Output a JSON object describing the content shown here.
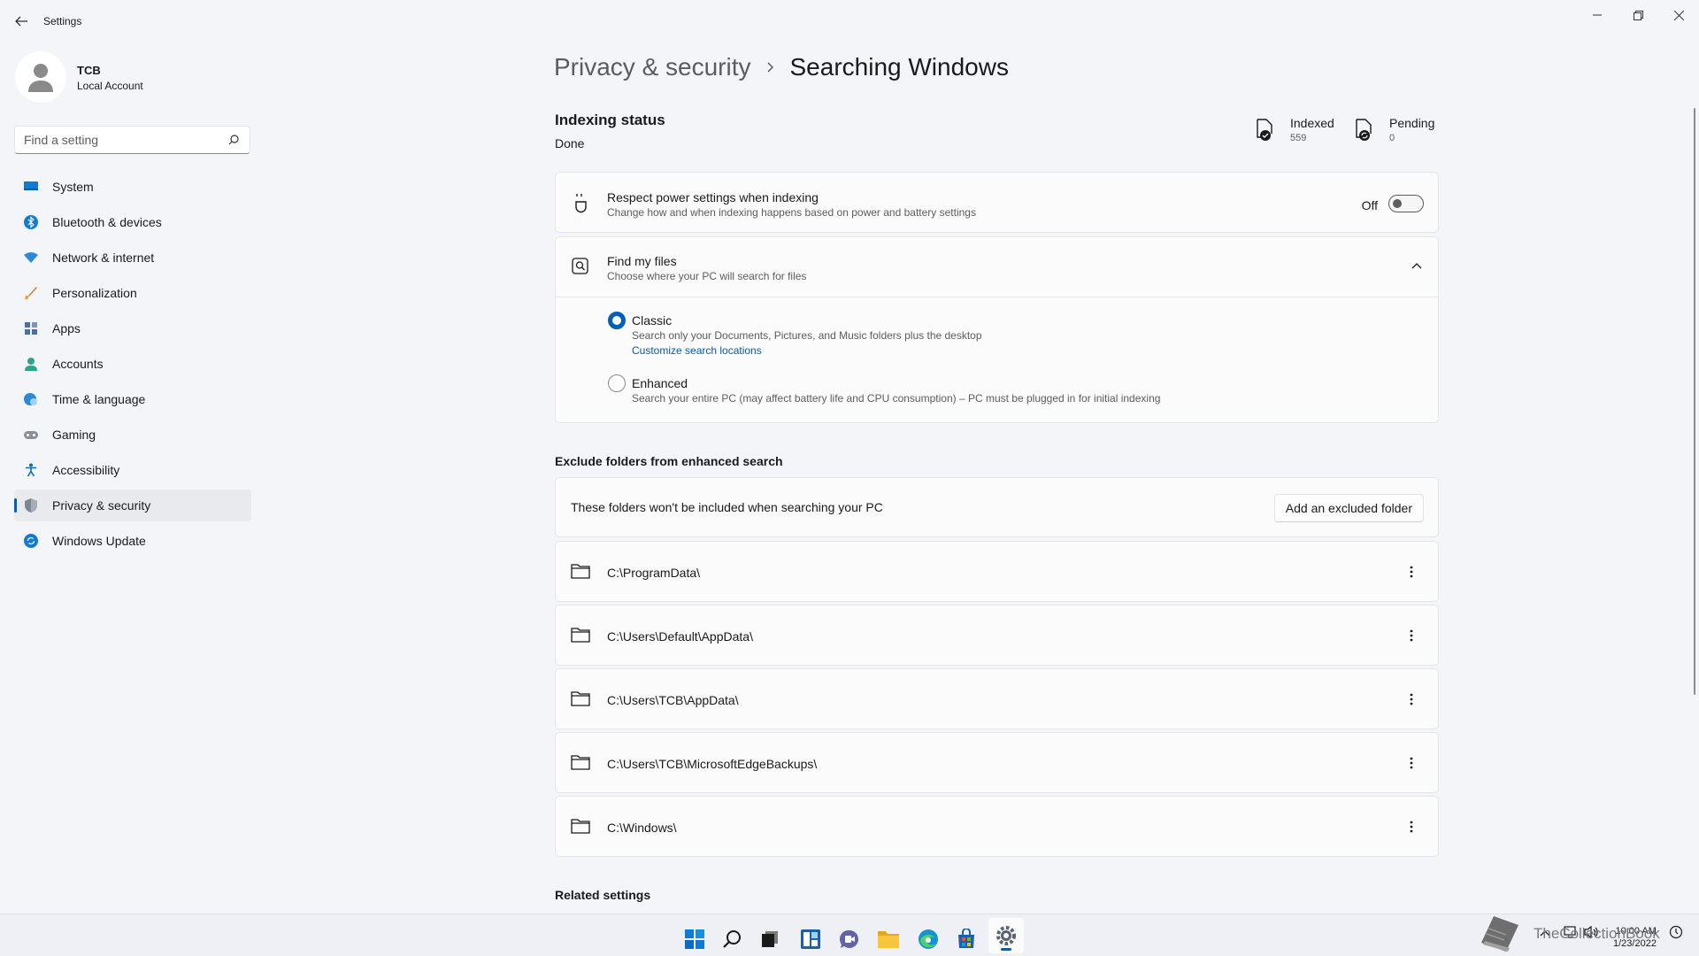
{
  "window": {
    "title": "Settings"
  },
  "profile": {
    "name": "TCB",
    "account_type": "Local Account"
  },
  "search": {
    "placeholder": "Find a setting"
  },
  "sidebar": {
    "items": [
      {
        "label": "System",
        "icon": "monitor-icon",
        "active": false
      },
      {
        "label": "Bluetooth & devices",
        "icon": "bluetooth-icon",
        "active": false
      },
      {
        "label": "Network & internet",
        "icon": "wifi-icon",
        "active": false
      },
      {
        "label": "Personalization",
        "icon": "brush-icon",
        "active": false
      },
      {
        "label": "Apps",
        "icon": "apps-icon",
        "active": false
      },
      {
        "label": "Accounts",
        "icon": "person-icon",
        "active": false
      },
      {
        "label": "Time & language",
        "icon": "globe-clock-icon",
        "active": false
      },
      {
        "label": "Gaming",
        "icon": "gamepad-icon",
        "active": false
      },
      {
        "label": "Accessibility",
        "icon": "accessibility-icon",
        "active": false
      },
      {
        "label": "Privacy & security",
        "icon": "shield-icon",
        "active": true
      },
      {
        "label": "Windows Update",
        "icon": "update-icon",
        "active": false
      }
    ]
  },
  "breadcrumb": {
    "parent": "Privacy & security",
    "separator": "›",
    "current": "Searching Windows"
  },
  "indexing": {
    "title": "Indexing status",
    "status": "Done",
    "indexed_label": "Indexed",
    "indexed_value": "559",
    "pending_label": "Pending",
    "pending_value": "0"
  },
  "power": {
    "title": "Respect power settings when indexing",
    "subtitle": "Change how and when indexing happens based on power and battery settings",
    "toggle_label": "Off",
    "toggle_on": false
  },
  "find_files": {
    "title": "Find my files",
    "subtitle": "Choose where your PC will search for files",
    "options": [
      {
        "label": "Classic",
        "description": "Search only your Documents, Pictures, and Music folders plus the desktop",
        "link": "Customize search locations",
        "selected": true
      },
      {
        "label": "Enhanced",
        "description": "Search your entire PC (may affect battery life and CPU consumption) – PC must be plugged in for initial indexing",
        "selected": false
      }
    ]
  },
  "exclude": {
    "section_title": "Exclude folders from enhanced search",
    "description": "These folders won't be included when searching your PC",
    "add_button": "Add an excluded folder",
    "folders": [
      "C:\\ProgramData\\",
      "C:\\Users\\Default\\AppData\\",
      "C:\\Users\\TCB\\AppData\\",
      "C:\\Users\\TCB\\MicrosoftEdgeBackups\\",
      "C:\\Windows\\"
    ]
  },
  "related": {
    "title": "Related settings"
  },
  "taskbar": {
    "apps": [
      "start-icon",
      "search-icon",
      "task-view-icon",
      "widgets-icon",
      "chat-icon",
      "file-explorer-icon",
      "edge-icon",
      "store-icon",
      "settings-icon"
    ],
    "clock_time": "10:00 AM",
    "clock_date": "1/23/2022"
  },
  "watermark": {
    "text": "TheCollectionBook"
  },
  "colors": {
    "accent": "#005fb8",
    "background": "#f3f5f9",
    "card": "#fbfbfc"
  }
}
